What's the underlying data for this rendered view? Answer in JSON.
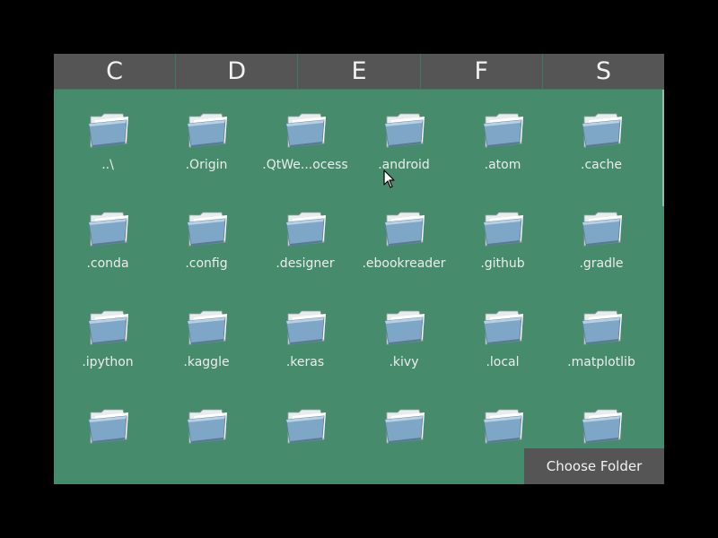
{
  "drives": [
    "C",
    "D",
    "E",
    "F",
    "S"
  ],
  "folders": [
    [
      "..\\",
      ".Origin",
      ".QtWe...ocess",
      ".android",
      ".atom",
      ".cache"
    ],
    [
      ".conda",
      ".config",
      ".designer",
      ".ebookreader",
      ".github",
      ".gradle"
    ],
    [
      ".ipython",
      ".kaggle",
      ".keras",
      ".kivy",
      ".local",
      ".matplotlib"
    ],
    [
      "",
      "",
      "",
      "",
      "",
      ""
    ]
  ],
  "folder_icon": "folder-icon",
  "actions": {
    "choose_folder_label": "Choose Folder"
  },
  "colors": {
    "background": "#468c6c",
    "tab": "#555555",
    "text": "#ececec"
  }
}
